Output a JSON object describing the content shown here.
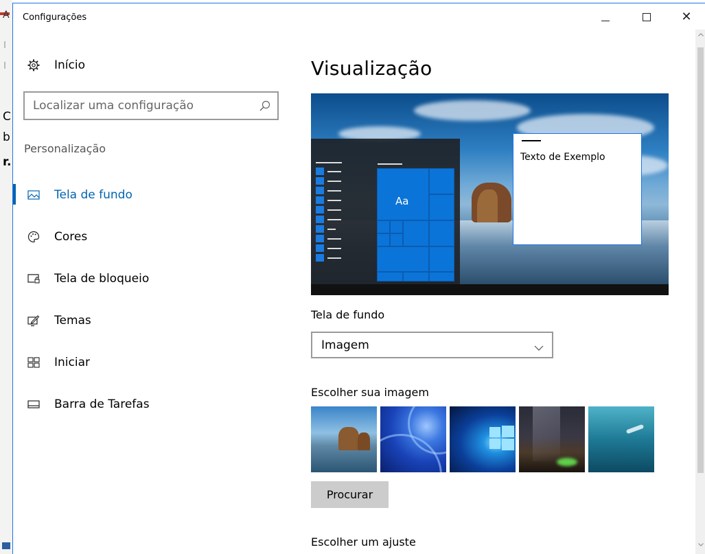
{
  "window": {
    "title": "Configurações",
    "controls": {
      "minimize": "–",
      "maximize": "□",
      "close": "✕"
    }
  },
  "background_window_chars": [
    "A",
    "C",
    "b",
    "r."
  ],
  "sidebar": {
    "home_label": "Início",
    "home_icon": "gear-icon",
    "search_placeholder": "Localizar uma configuração",
    "search_icon": "search-icon",
    "section_label": "Personalização",
    "items": [
      {
        "label": "Tela de fundo",
        "icon": "picture-icon",
        "active": true
      },
      {
        "label": "Cores",
        "icon": "palette-icon",
        "active": false
      },
      {
        "label": "Tela de bloqueio",
        "icon": "lock-screen-icon",
        "active": false
      },
      {
        "label": "Temas",
        "icon": "themes-icon",
        "active": false
      },
      {
        "label": "Iniciar",
        "icon": "start-tiles-icon",
        "active": false
      },
      {
        "label": "Barra de Tarefas",
        "icon": "taskbar-icon",
        "active": false
      }
    ]
  },
  "main": {
    "title": "Visualização",
    "preview": {
      "tile_label": "Aa",
      "sample_text": "Texto de Exemplo"
    },
    "background_label": "Tela de fundo",
    "background_select": {
      "value": "Imagem"
    },
    "choose_image_label": "Escolher sua imagem",
    "thumbnails": [
      "beach-rocks",
      "blue-abstract",
      "windows-logo",
      "night-sky",
      "underwater-swimmer"
    ],
    "browse_button": "Procurar",
    "choose_fit_label": "Escolher um ajuste"
  },
  "colors": {
    "accent": "#0063b1",
    "tile_blue": "#0b74d8",
    "button_gray": "#cccccc"
  }
}
